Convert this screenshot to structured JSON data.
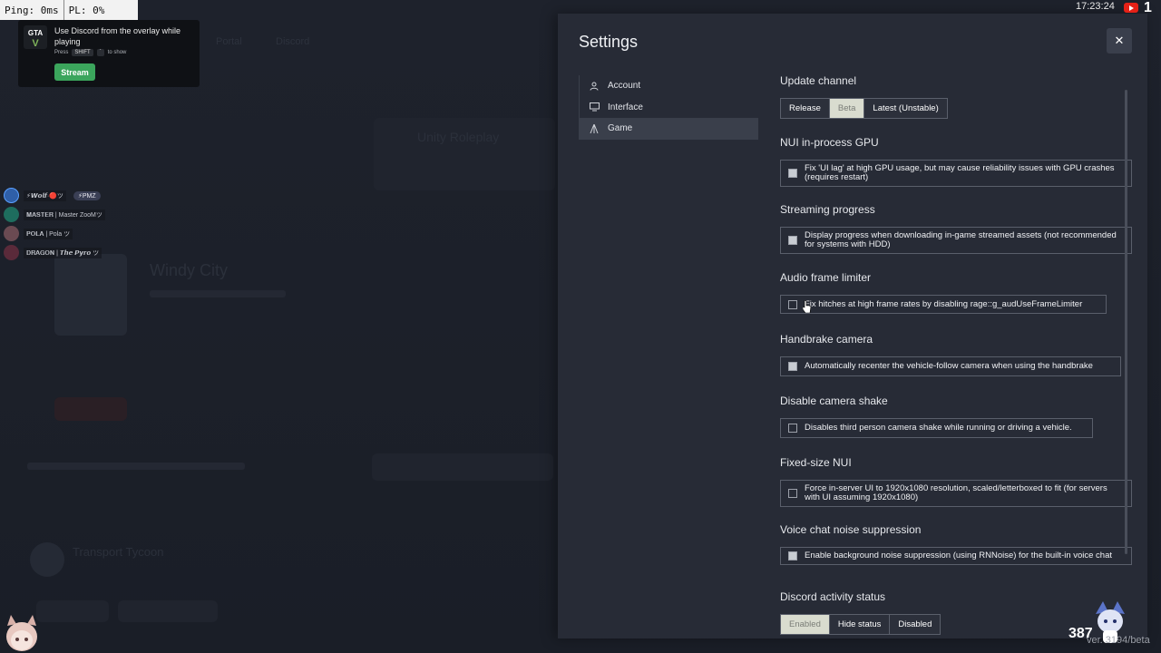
{
  "overlay": {
    "ping": "Ping: 0ms",
    "pl": "PL: 0%",
    "toast_title": "Use Discord from the overlay while playing",
    "toast_press": "Press",
    "toast_key": "SHIFT",
    "toast_key2": "`",
    "toast_to_show": "to show",
    "stream_label": "Stream"
  },
  "voice": [
    {
      "name": "⚡𝙒𝙤𝙡𝙛·🔴ツ",
      "badge": "⚡PMZ",
      "color": "#2f5fa8"
    },
    {
      "name": "𝐌𝐀𝐒𝐓𝐄𝐑 | Master ZooMツ",
      "color": "#1e6d5e"
    },
    {
      "name": "𝐏𝐎𝐋𝐀 | Pola ツ",
      "color": "#6a4a52"
    },
    {
      "name": "𝐃𝐑𝐀𝐆𝐎𝐍 | 𝙏𝙝𝙚 𝙋𝙮𝙧𝙤 ツ",
      "color": "#5a2a3a"
    }
  ],
  "background": {
    "server1": "Unity Roleplay",
    "server2": "Windy City",
    "server3": "Transport Tycoon"
  },
  "settings": {
    "title": "Settings",
    "close_glyph": "✕",
    "nav": [
      {
        "label": "Account",
        "icon": "person-icon"
      },
      {
        "label": "Interface",
        "icon": "monitor-icon"
      },
      {
        "label": "Game",
        "icon": "game-icon",
        "active": true
      }
    ],
    "update_channel": {
      "title": "Update channel",
      "options": [
        "Release",
        "Beta",
        "Latest (Unstable)"
      ],
      "selected": "Beta"
    },
    "nui_gpu": {
      "title": "NUI in-process GPU",
      "label": "Fix 'UI lag' at high GPU usage, but may cause reliability issues with GPU crashes (requires restart)",
      "checked": true
    },
    "streaming": {
      "title": "Streaming progress",
      "label": "Display progress when downloading in-game streamed assets (not recommended for systems with HDD)",
      "checked": true
    },
    "audio_limiter": {
      "title": "Audio frame limiter",
      "label": "Fix hitches at high frame rates by disabling rage::g_audUseFrameLimiter",
      "checked": false
    },
    "handbrake": {
      "title": "Handbrake camera",
      "label": "Automatically recenter the vehicle-follow camera when using the handbrake",
      "checked": true
    },
    "camera_shake": {
      "title": "Disable camera shake",
      "label": "Disables third person camera shake while running or driving a vehicle.",
      "checked": false
    },
    "fixed_nui": {
      "title": "Fixed-size NUI",
      "label": "Force in-server UI to 1920x1080 resolution, scaled/letterboxed to fit (for servers with UI assuming 1920x1080)",
      "checked": false
    },
    "noise": {
      "title": "Voice chat noise suppression",
      "label": "Enable background noise suppression (using RNNoise) for the built-in voice chat",
      "checked": true
    },
    "discord": {
      "title": "Discord activity status",
      "options": [
        "Enabled",
        "Hide status",
        "Disabled"
      ],
      "selected": "Enabled"
    }
  },
  "stream_overlay": {
    "clock": "17:23:24",
    "corner_count": "1",
    "viewers": "387",
    "version": "ver. 3194/beta"
  },
  "colors": {
    "panel": "#272b36",
    "accent_green": "#3ba55c",
    "selected_seg": "#d9dccf"
  }
}
